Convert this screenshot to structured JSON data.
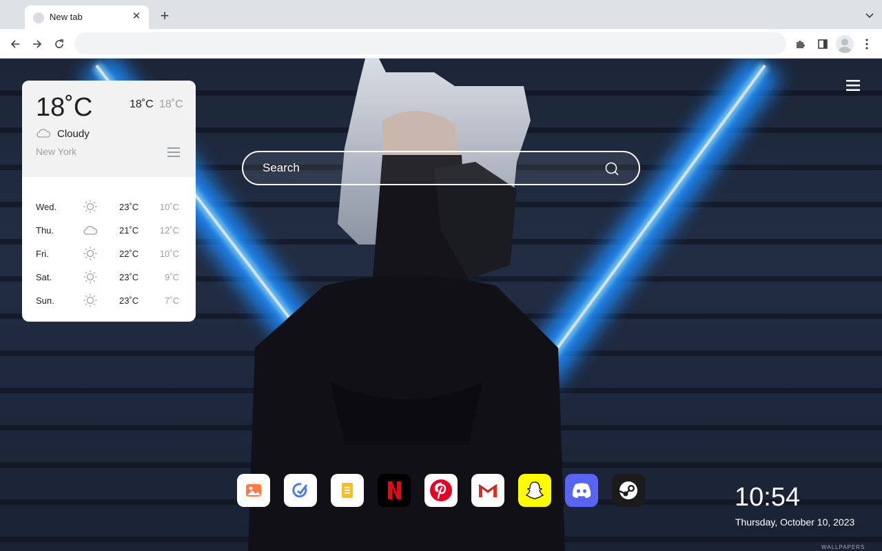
{
  "browser": {
    "tab": {
      "title": "New tab",
      "close": "✕"
    },
    "new_tab": "+",
    "omnibox": {
      "value": "",
      "placeholder": ""
    }
  },
  "weather": {
    "current_temp": "18˚C",
    "high": "18˚C",
    "low": "18˚C",
    "condition": "Cloudy",
    "condition_icon": "cloud-icon",
    "city": "New York",
    "forecast": [
      {
        "day": "Wed.",
        "icon": "sun-icon",
        "high": "23˚C",
        "low": "10˚C"
      },
      {
        "day": "Thu.",
        "icon": "cloud-icon",
        "high": "21˚C",
        "low": "12˚C"
      },
      {
        "day": "Fri.",
        "icon": "sun-icon",
        "high": "22˚C",
        "low": "10˚C"
      },
      {
        "day": "Sat.",
        "icon": "sun-icon",
        "high": "23˚C",
        "low": "9˚C"
      },
      {
        "day": "Sun.",
        "icon": "sun-icon",
        "high": "23˚C",
        "low": "7˚C"
      }
    ]
  },
  "search": {
    "placeholder": "Search"
  },
  "dock": [
    {
      "name": "gallery",
      "icon": "photo-icon",
      "color": "#ffffff"
    },
    {
      "name": "tasks",
      "icon": "check-icon",
      "color": "#ffffff"
    },
    {
      "name": "notes",
      "icon": "note-icon",
      "color": "#ffffff"
    },
    {
      "name": "netflix",
      "icon": "netflix-icon",
      "color": "#000000"
    },
    {
      "name": "pinterest",
      "icon": "pinterest-icon",
      "color": "#ffffff"
    },
    {
      "name": "gmail",
      "icon": "gmail-icon",
      "color": "#ffffff"
    },
    {
      "name": "snapchat",
      "icon": "snapchat-icon",
      "color": "#fffc00"
    },
    {
      "name": "discord",
      "icon": "discord-icon",
      "color": "#5865f2"
    },
    {
      "name": "steam",
      "icon": "steam-icon",
      "color": "#1b1b1b"
    }
  ],
  "clock": {
    "time": "10:54",
    "date": "Thursday, October 10, 2023"
  },
  "watermark": "WALLPAPERS"
}
